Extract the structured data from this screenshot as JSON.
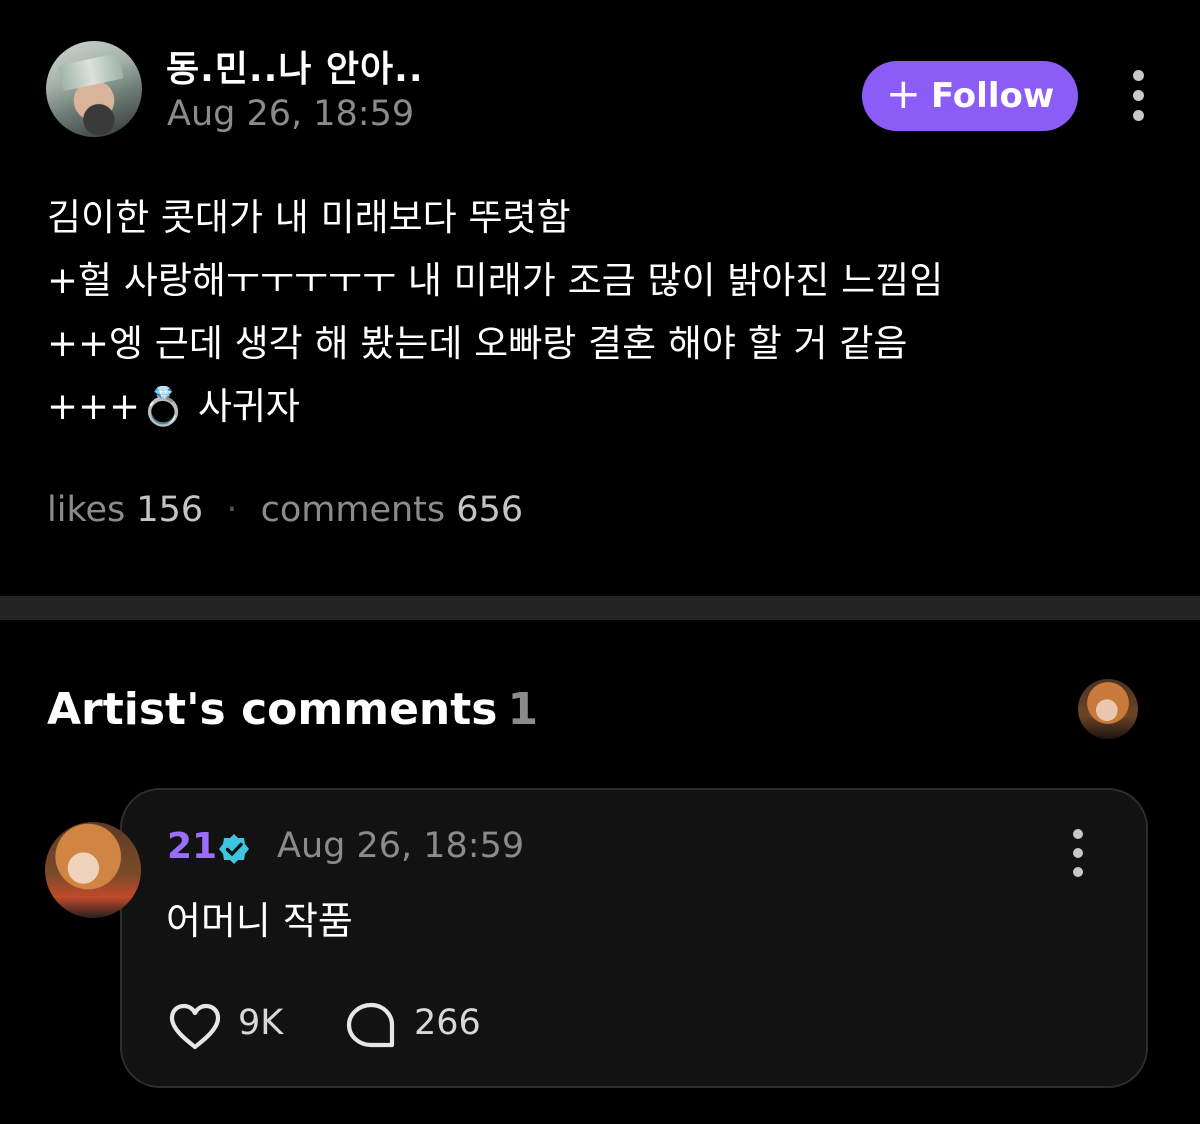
{
  "post": {
    "author_name": "동.민..나 안아..",
    "date": "Aug 26, 18:59",
    "follow_label": "Follow",
    "body_lines": [
      "김이한 콧대가 내 미래보다 뚜렷함",
      "+헐 사랑해ㅜㅜㅜㅜㅜ 내 미래가 조금 많이 밝아진 느낌임",
      "++엥 근데 생각 해 봤는데 오빠랑 결혼 해야 할 거 같음",
      "+++💍 사귀자"
    ],
    "stats": {
      "likes_label": "likes",
      "likes_count": "156",
      "separator": "·",
      "comments_label": "comments",
      "comments_count": "656"
    }
  },
  "artist_comments": {
    "title": "Artist's comments",
    "count": "1",
    "comment": {
      "author": "21",
      "verified": true,
      "date": "Aug 26, 18:59",
      "text": "어머니 작품",
      "like_count": "9K",
      "reply_count": "266"
    }
  },
  "icons": {
    "follow": "plus-icon",
    "more": "more-vertical-icon",
    "verified": "verified-badge-icon",
    "like": "heart-icon",
    "reply": "comment-bubble-icon"
  },
  "colors": {
    "background": "#000000",
    "accent": "#8b5cf6",
    "artist_name": "#9b6dff",
    "verified_badge": "#3ec6e0",
    "muted_text": "#8b8b8b",
    "divider": "#232323",
    "card_background": "#121212"
  }
}
